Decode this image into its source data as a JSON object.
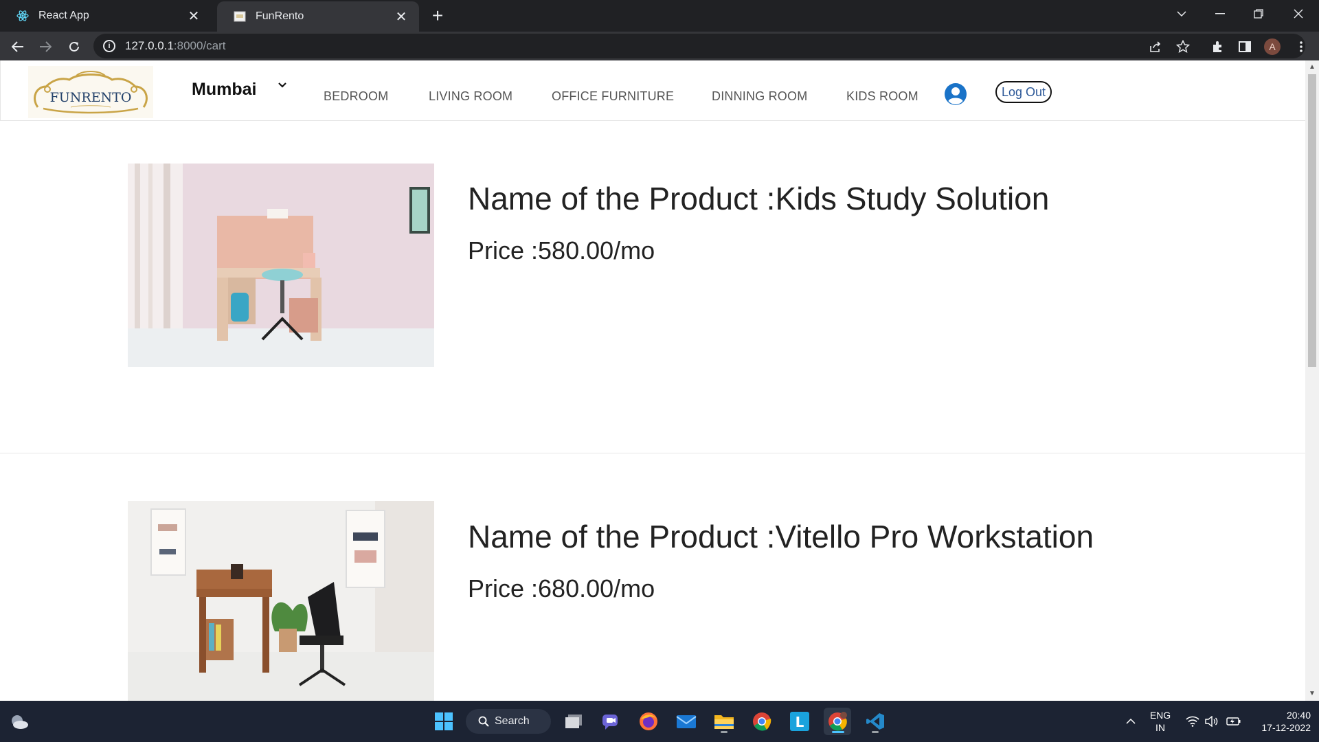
{
  "browser": {
    "tabs": [
      {
        "title": "React App",
        "active": false,
        "icon": "react-icon"
      },
      {
        "title": "FunRento",
        "active": true,
        "icon": "page-favicon"
      }
    ],
    "url_host": "127.0.0.1",
    "url_path": ":8000/cart",
    "profile_initial": "A"
  },
  "site": {
    "logo_text": "FUNRENTO",
    "city": "Mumbai",
    "nav_links": [
      "BEDROOM",
      "LIVING ROOM",
      "OFFICE FURNITURE",
      "DINNING ROOM",
      "KIDS ROOM"
    ],
    "logout_label": "Log Out"
  },
  "cart": {
    "items": [
      {
        "name": "Name of the Product :Kids Study Solution",
        "price": "Price :580.00/mo"
      },
      {
        "name": "Name of the Product :Vitello Pro Workstation",
        "price": "Price :680.00/mo"
      }
    ]
  },
  "taskbar": {
    "search_label": "Search",
    "lang_top": "ENG",
    "lang_bottom": "IN",
    "time": "20:40",
    "date": "17-12-2022"
  },
  "colors": {
    "chrome_dark": "#202124",
    "chrome_toolbar": "#35363a",
    "user_icon": "#1a73c8",
    "logout_text": "#2b5797",
    "taskbar": "#1c2333"
  }
}
